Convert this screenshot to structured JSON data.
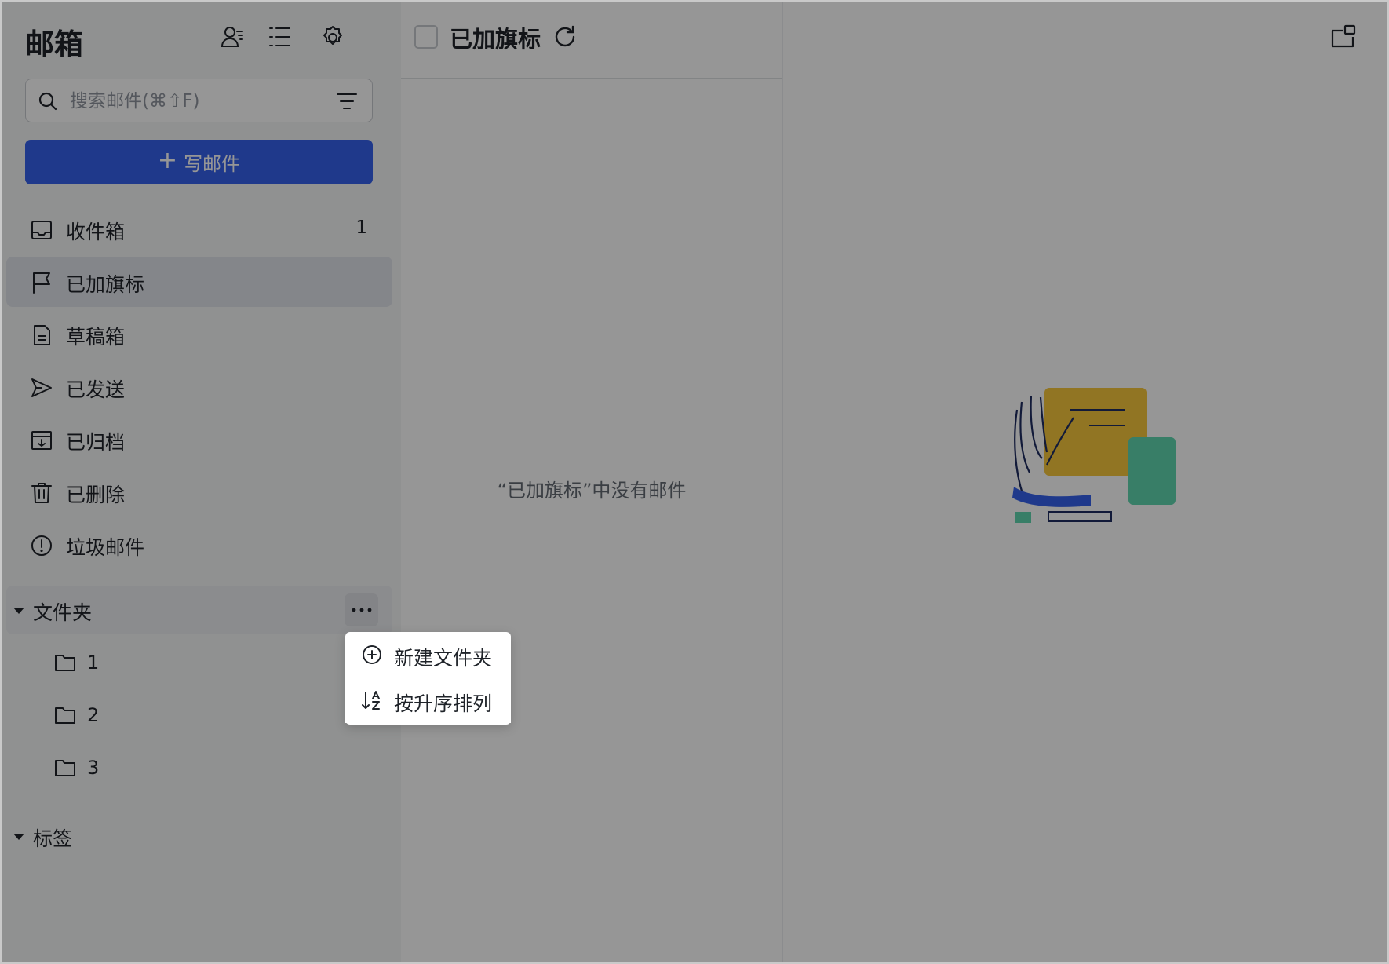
{
  "sidebar": {
    "title": "邮箱",
    "header_icons": [
      "contacts-icon",
      "list-view-icon",
      "settings-icon"
    ],
    "search": {
      "placeholder": "搜索邮件(⌘⇧F)",
      "value": ""
    },
    "compose_label": "写邮件",
    "nav": [
      {
        "label": "收件箱",
        "icon": "inbox-icon",
        "count": "1"
      },
      {
        "label": "已加旗标",
        "icon": "flag-icon",
        "count": ""
      },
      {
        "label": "草稿箱",
        "icon": "draft-icon",
        "count": ""
      },
      {
        "label": "已发送",
        "icon": "send-icon",
        "count": ""
      },
      {
        "label": "已归档",
        "icon": "archive-icon",
        "count": ""
      },
      {
        "label": "已删除",
        "icon": "trash-icon",
        "count": ""
      },
      {
        "label": "垃圾邮件",
        "icon": "spam-icon",
        "count": ""
      }
    ],
    "folders_section": {
      "label": "文件夹",
      "items": [
        "1",
        "2",
        "3"
      ]
    },
    "labels_section": {
      "label": "标签"
    }
  },
  "list": {
    "title": "已加旗标",
    "empty_message": "“已加旗标”中没有邮件"
  },
  "context_menu": {
    "items": [
      {
        "label": "新建文件夹",
        "icon": "plus-circle-icon"
      },
      {
        "label": "按升序排列",
        "icon": "sort-ascending-icon"
      }
    ]
  },
  "colors": {
    "accent": "#3662ec",
    "active_nav": "#e1e4ea",
    "overlay": "rgba(0,0,0,0.41)"
  }
}
